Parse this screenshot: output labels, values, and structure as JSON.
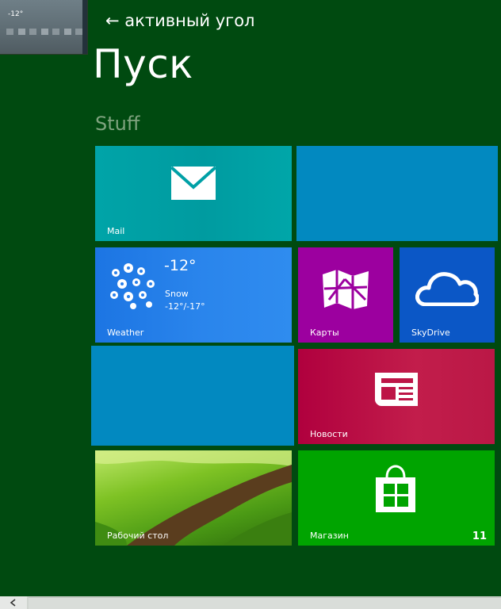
{
  "hint": {
    "arrow": "←",
    "label": "активный угол"
  },
  "corner_preview": {
    "temperature": "-12°"
  },
  "start": {
    "title": "Пуск",
    "group": "Stuff"
  },
  "tiles": {
    "mail": {
      "label": "Mail",
      "color": "#00a0a6",
      "icon": "mail-icon"
    },
    "blank_top": {
      "color": "#0289c0"
    },
    "weather": {
      "label": "Weather",
      "temperature": "-12°",
      "condition": "Snow",
      "range": "-12°/-17°",
      "color": "#2a80ea",
      "icon": "snowflakes-icon"
    },
    "maps": {
      "label": "Карты",
      "color": "#9c009f",
      "icon": "map-icon"
    },
    "skydrive": {
      "label": "SkyDrive",
      "color": "#0b57c6",
      "icon": "cloud-icon"
    },
    "blank_middle": {
      "color": "#0289c0"
    },
    "news": {
      "label": "Новости",
      "color": "#bd1547",
      "icon": "newspaper-icon"
    },
    "desktop": {
      "label": "Рабочий стол",
      "icon": "landscape-wallpaper"
    },
    "store": {
      "label": "Магазин",
      "badge": "11",
      "color": "#00a400",
      "icon": "shopping-bag-icon"
    }
  },
  "scrollbar": {
    "left_arrow": "chevron-left-icon"
  }
}
